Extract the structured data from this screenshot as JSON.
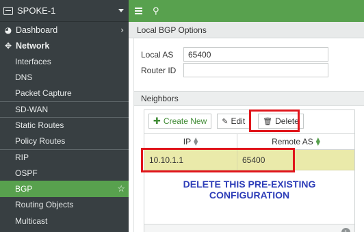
{
  "sidebar": {
    "device_name": "SPOKE-1",
    "top_items": {
      "dashboard": "Dashboard",
      "network": "Network"
    },
    "items": [
      {
        "label": "Interfaces"
      },
      {
        "label": "DNS"
      },
      {
        "label": "Packet Capture"
      },
      {
        "label": "SD-WAN"
      },
      {
        "label": "Static Routes"
      },
      {
        "label": "Policy Routes"
      },
      {
        "label": "RIP"
      },
      {
        "label": "OSPF"
      },
      {
        "label": "BGP"
      },
      {
        "label": "Routing Objects"
      },
      {
        "label": "Multicast"
      }
    ],
    "active_item": "BGP",
    "colors": {
      "background": "#383f42",
      "active": "#58a14e"
    }
  },
  "topbar": {
    "color": "#58a14e",
    "menu_icon": "hamburger-icon",
    "search_icon": "search-icon"
  },
  "page_title": "Local BGP Options",
  "form": {
    "local_as_label": "Local AS",
    "local_as_value": "65400",
    "router_id_label": "Router ID",
    "router_id_value": ""
  },
  "neighbors": {
    "title": "Neighbors",
    "toolbar": {
      "create_label": "Create New",
      "edit_label": "Edit",
      "delete_label": "Delete"
    },
    "columns": [
      "IP",
      "Remote AS"
    ],
    "rows": [
      {
        "ip": "10.10.1.1",
        "remote_as": "65400"
      }
    ],
    "count": "1"
  },
  "annotation": {
    "text": "DELETE THIS PRE-EXISTING CONFIGURATION",
    "text_color": "#2d3db8",
    "highlight_color": "#e0151b"
  }
}
